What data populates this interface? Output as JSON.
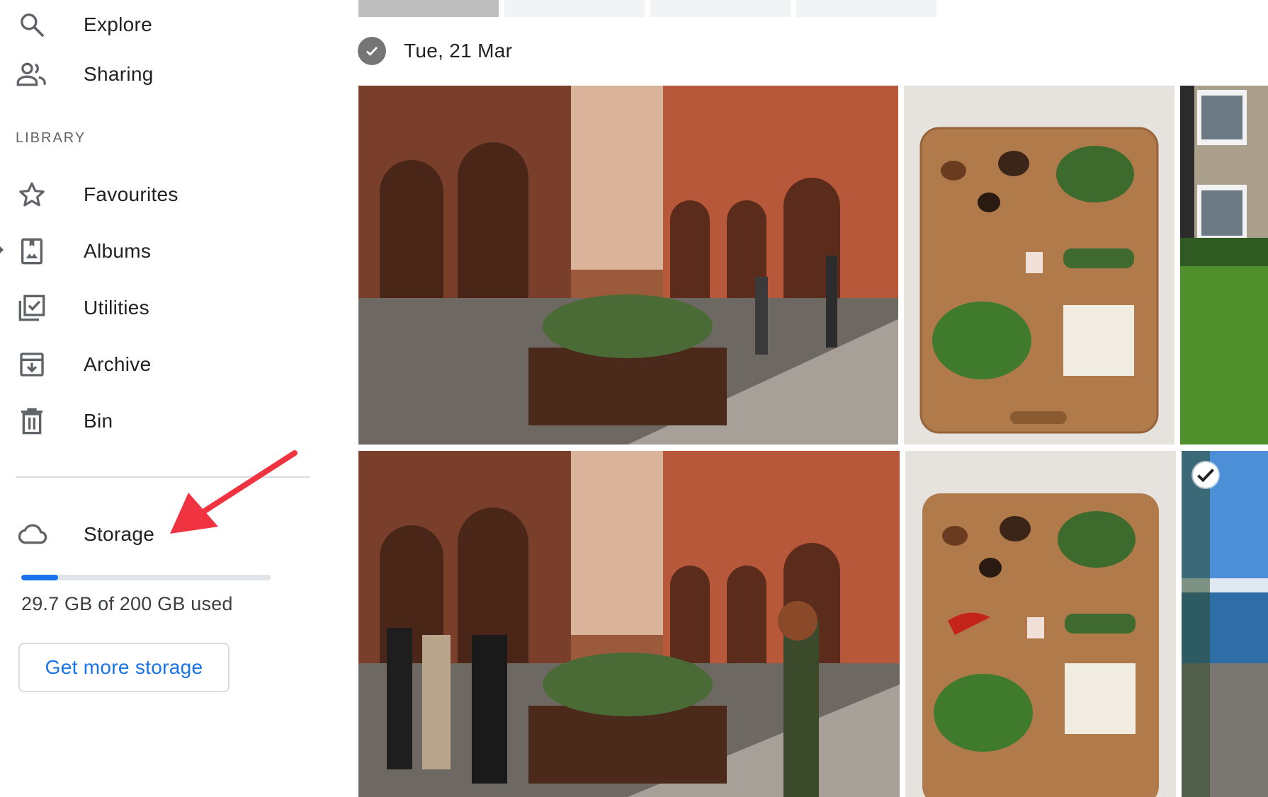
{
  "sidebar": {
    "items": [
      {
        "label": "Explore",
        "icon": "search-icon"
      },
      {
        "label": "Sharing",
        "icon": "people-icon"
      }
    ],
    "library_header": "LIBRARY",
    "library_items": [
      {
        "label": "Favourites",
        "icon": "star-icon"
      },
      {
        "label": "Albums",
        "icon": "album-icon"
      },
      {
        "label": "Utilities",
        "icon": "utilities-icon"
      },
      {
        "label": "Archive",
        "icon": "archive-icon"
      },
      {
        "label": "Bin",
        "icon": "bin-icon"
      }
    ],
    "storage": {
      "label": "Storage",
      "icon": "cloud-icon",
      "used_text": "29.7 GB of 200 GB used",
      "used_fraction": 0.1485,
      "button_label": "Get more storage"
    }
  },
  "main": {
    "date_group_label": "Tue, 21 Mar",
    "photos": [
      {
        "subject": "street-with-arcades"
      },
      {
        "subject": "cutting-board-ingredients"
      },
      {
        "subject": "house-and-lawn"
      },
      {
        "subject": "street-with-arcades-people"
      },
      {
        "subject": "cutting-board-ingredients-chili"
      },
      {
        "subject": "lake-and-beach",
        "selected": true
      }
    ]
  },
  "colors": {
    "accent": "#1a73e8",
    "annotation_arrow": "#ef3340",
    "text": "#202124",
    "muted": "#5f6368"
  }
}
